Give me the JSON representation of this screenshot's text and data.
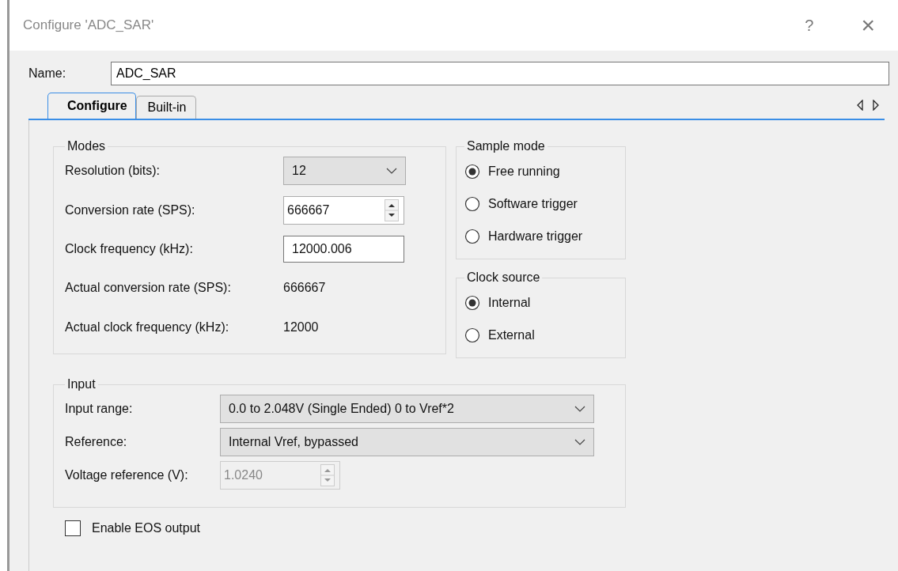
{
  "window": {
    "title": "Configure 'ADC_SAR'",
    "help": "?",
    "close": "×"
  },
  "name_field": {
    "label": "Name:",
    "value": "ADC_SAR"
  },
  "tabs": [
    {
      "label": "Configure",
      "selected": true
    },
    {
      "label": "Built-in",
      "selected": false
    }
  ],
  "modes": {
    "title": "Modes",
    "rows": [
      {
        "kind": "select",
        "label": "Resolution (bits):",
        "value": "12"
      },
      {
        "kind": "spin",
        "label": "Conversion rate (SPS):",
        "value": "666667",
        "disabled": false
      },
      {
        "kind": "text",
        "label": "Clock frequency (kHz):",
        "value": "12000.006"
      },
      {
        "kind": "readout",
        "label": "Actual conversion rate (SPS):",
        "value": "666667"
      },
      {
        "kind": "readout",
        "label": "Actual clock frequency (kHz):",
        "value": "12000"
      }
    ]
  },
  "sample_mode": {
    "title": "Sample mode",
    "options": [
      {
        "label": "Free running",
        "selected": true
      },
      {
        "label": "Software trigger",
        "selected": false
      },
      {
        "label": "Hardware trigger",
        "selected": false
      }
    ]
  },
  "clock_source": {
    "title": "Clock source",
    "options": [
      {
        "label": "Internal",
        "selected": true
      },
      {
        "label": "External",
        "selected": false
      }
    ]
  },
  "input": {
    "title": "Input",
    "rows": [
      {
        "kind": "select",
        "label": "Input range:",
        "value": "0.0 to 2.048V (Single Ended) 0 to Vref*2"
      },
      {
        "kind": "select",
        "label": "Reference:",
        "value": "Internal Vref, bypassed"
      },
      {
        "kind": "spin",
        "label": "Voltage reference (V):",
        "value": "1.0240",
        "disabled": true
      }
    ]
  },
  "eos_output": {
    "label": "Enable EOS output",
    "checked": false
  }
}
